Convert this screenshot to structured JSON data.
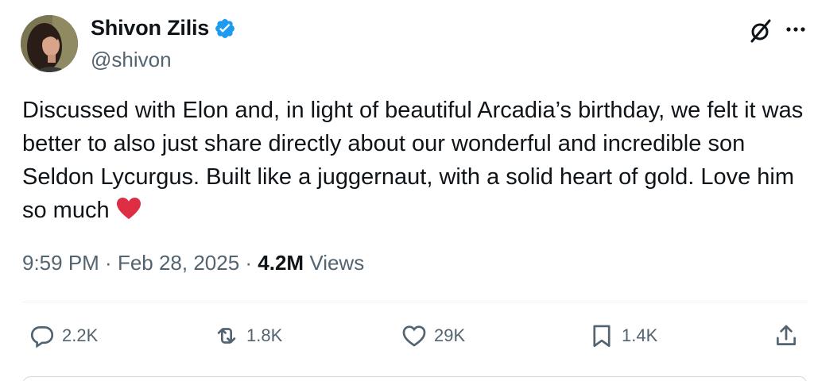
{
  "author": {
    "display_name": "Shivon Zilis",
    "handle": "@shivon",
    "verified": true,
    "verified_color": "#1d9bf0"
  },
  "header_icons": {
    "grok": "grok-icon",
    "more": "more-icon"
  },
  "tweet": {
    "text": "Discussed with Elon and, in light of beautiful Arcadia’s birthday, we felt it was better to also just share directly about our wonderful and incredible son Seldon Lycurgus. Built like a juggernaut, with a solid heart of gold. Love him so much",
    "emoji": "red-heart",
    "time": "9:59 PM",
    "separator": " · ",
    "date": "Feb 28, 2025",
    "views_count": "4.2M",
    "views_label": "Views"
  },
  "actions": {
    "replies": {
      "icon": "reply-icon",
      "count": "2.2K"
    },
    "reposts": {
      "icon": "repost-icon",
      "count": "1.8K"
    },
    "likes": {
      "icon": "like-icon",
      "count": "29K"
    },
    "bookmarks": {
      "icon": "bookmark-icon",
      "count": "1.4K"
    },
    "share": {
      "icon": "share-icon"
    }
  },
  "colors": {
    "text_primary": "#0f1419",
    "text_secondary": "#536471",
    "emoji_heart": "#dd2e44"
  }
}
